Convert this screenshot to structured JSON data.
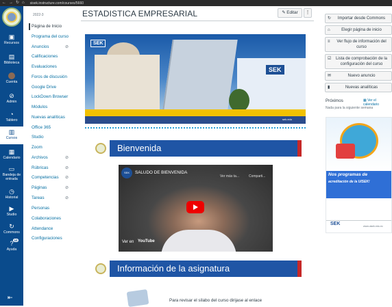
{
  "browser": {
    "url": "sisek.instructure.com/courses/5660",
    "back": "←",
    "forward": "→",
    "reload": "↻",
    "home": "⌂"
  },
  "global_nav": {
    "items": [
      {
        "label": "Recursos",
        "icon": "resources-icon"
      },
      {
        "label": "Biblioteca",
        "icon": "library-icon"
      },
      {
        "label": "Cuenta",
        "icon": "account-avatar"
      },
      {
        "label": "Admin",
        "icon": "admin-icon"
      },
      {
        "label": "Tablero",
        "icon": "dashboard-icon"
      },
      {
        "label": "Cursos",
        "icon": "courses-icon"
      },
      {
        "label": "Calendario",
        "icon": "calendar-icon"
      },
      {
        "label": "Bandeja de entrada",
        "icon": "inbox-icon"
      },
      {
        "label": "Historial",
        "icon": "history-icon"
      },
      {
        "label": "Studio",
        "icon": "studio-icon"
      },
      {
        "label": "Commons",
        "icon": "commons-icon"
      },
      {
        "label": "Ayuda",
        "icon": "help-icon",
        "badge": "10"
      }
    ]
  },
  "course_nav": {
    "term": "2022-3",
    "items": [
      {
        "label": "Página de Inicio",
        "active": true
      },
      {
        "label": "Programa del curso"
      },
      {
        "label": "Anuncios",
        "hidden": true
      },
      {
        "label": "Calificaciones"
      },
      {
        "label": "Evaluaciones"
      },
      {
        "label": "Foros de discusión"
      },
      {
        "label": "Google Drive"
      },
      {
        "label": "LockDown Browser"
      },
      {
        "label": "Módulos"
      },
      {
        "label": "Nuevas analíticas"
      },
      {
        "label": "Office 365"
      },
      {
        "label": "Studio"
      },
      {
        "label": "Zoom"
      },
      {
        "label": "Archivos",
        "hidden": true
      },
      {
        "label": "Rúbricas",
        "hidden": true
      },
      {
        "label": "Competencias",
        "hidden": true
      },
      {
        "label": "Páginas",
        "hidden": true
      },
      {
        "label": "Tareas",
        "hidden": true
      },
      {
        "label": "Personas"
      },
      {
        "label": "Colaboraciones"
      },
      {
        "label": "Attendance"
      },
      {
        "label": "Configuraciones"
      }
    ]
  },
  "header": {
    "title": "ESTADISTICA EMPRESARIAL",
    "edit_label": "Editar",
    "more_label": "⋮"
  },
  "banner": {
    "logo_text": "SEK",
    "building_logo": "SEK",
    "credit": "sek.edu"
  },
  "sections": [
    {
      "title": "Bienvenida"
    },
    {
      "title": "Información de la asignatura"
    }
  ],
  "video": {
    "channel_logo": "SEK",
    "title": "SALUDO DE BIENVENIDA",
    "watch_later": "Ver más ta...",
    "share": "Comparti...",
    "watch_on": "Ver en",
    "youtube": "YouTube"
  },
  "paragraph": "Para revisar el sílabo del curso dirijase al enlace",
  "sidebar": {
    "buttons": [
      {
        "label": "Importar desde Commons",
        "icon": "commons-icon"
      },
      {
        "label": "Elegir página de inicio",
        "icon": "home-icon"
      },
      {
        "label": "Ver flujo de información del curso",
        "icon": "stream-icon"
      },
      {
        "label": "Lista de comprobación de la configuración del curso",
        "icon": "checklist-icon"
      },
      {
        "label": "Nuevo anuncio",
        "icon": "announcement-icon"
      },
      {
        "label": "Nuevas analíticas",
        "icon": "analytics-icon"
      }
    ],
    "upcoming_title": "Próximos",
    "calendar_link": "Ver el calendario",
    "nothing_text": "Nada para la siguiente semana",
    "ad": {
      "line1": "Nos programas de",
      "line2": "acreditación de la UISEK!",
      "brand": "SEK",
      "web": "www.uisek.edu.ec"
    }
  }
}
